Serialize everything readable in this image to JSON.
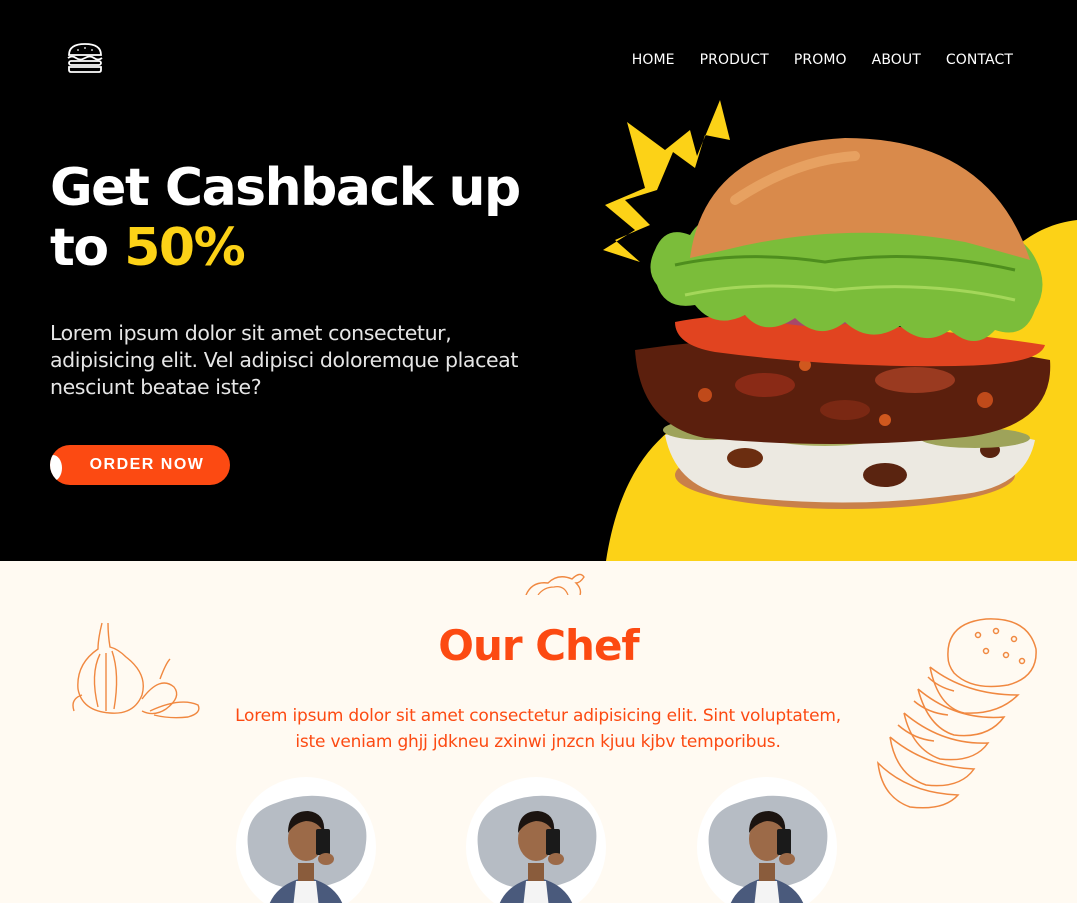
{
  "nav": {
    "logo_icon": "burger-logo-icon",
    "items": [
      {
        "label": "HOME"
      },
      {
        "label": "PRODUCT"
      },
      {
        "label": "PROMO"
      },
      {
        "label": "ABOUT"
      },
      {
        "label": "CONTACT"
      }
    ]
  },
  "hero": {
    "headline_line1": "Get Cashback up",
    "headline_to": "to",
    "headline_accent": "50%",
    "description": "Lorem ipsum dolor sit amet consectetur, adipisicing elit. Vel adipisci doloremque placeat nesciunt beatae iste?",
    "cta_label": "ORDER NOW",
    "image": "burger-image"
  },
  "chef_section": {
    "title": "Our Chef",
    "description": "Lorem ipsum dolor sit amet consectetur adipisicing elit. Sint voluptatem, iste veniam ghjj jdkneu zxinwi jnzcn kjuu kjbv temporibus.",
    "decorations": [
      "garlic-sketch",
      "burger-sketch",
      "onion-sketch"
    ],
    "chefs": [
      {
        "image": "chef-photo"
      },
      {
        "image": "chef-photo"
      },
      {
        "image": "chef-photo"
      }
    ]
  },
  "colors": {
    "brand_orange": "#fc4a12",
    "accent_yellow": "#fcd217",
    "hero_bg": "#000000",
    "section_bg": "#fffaf2"
  }
}
